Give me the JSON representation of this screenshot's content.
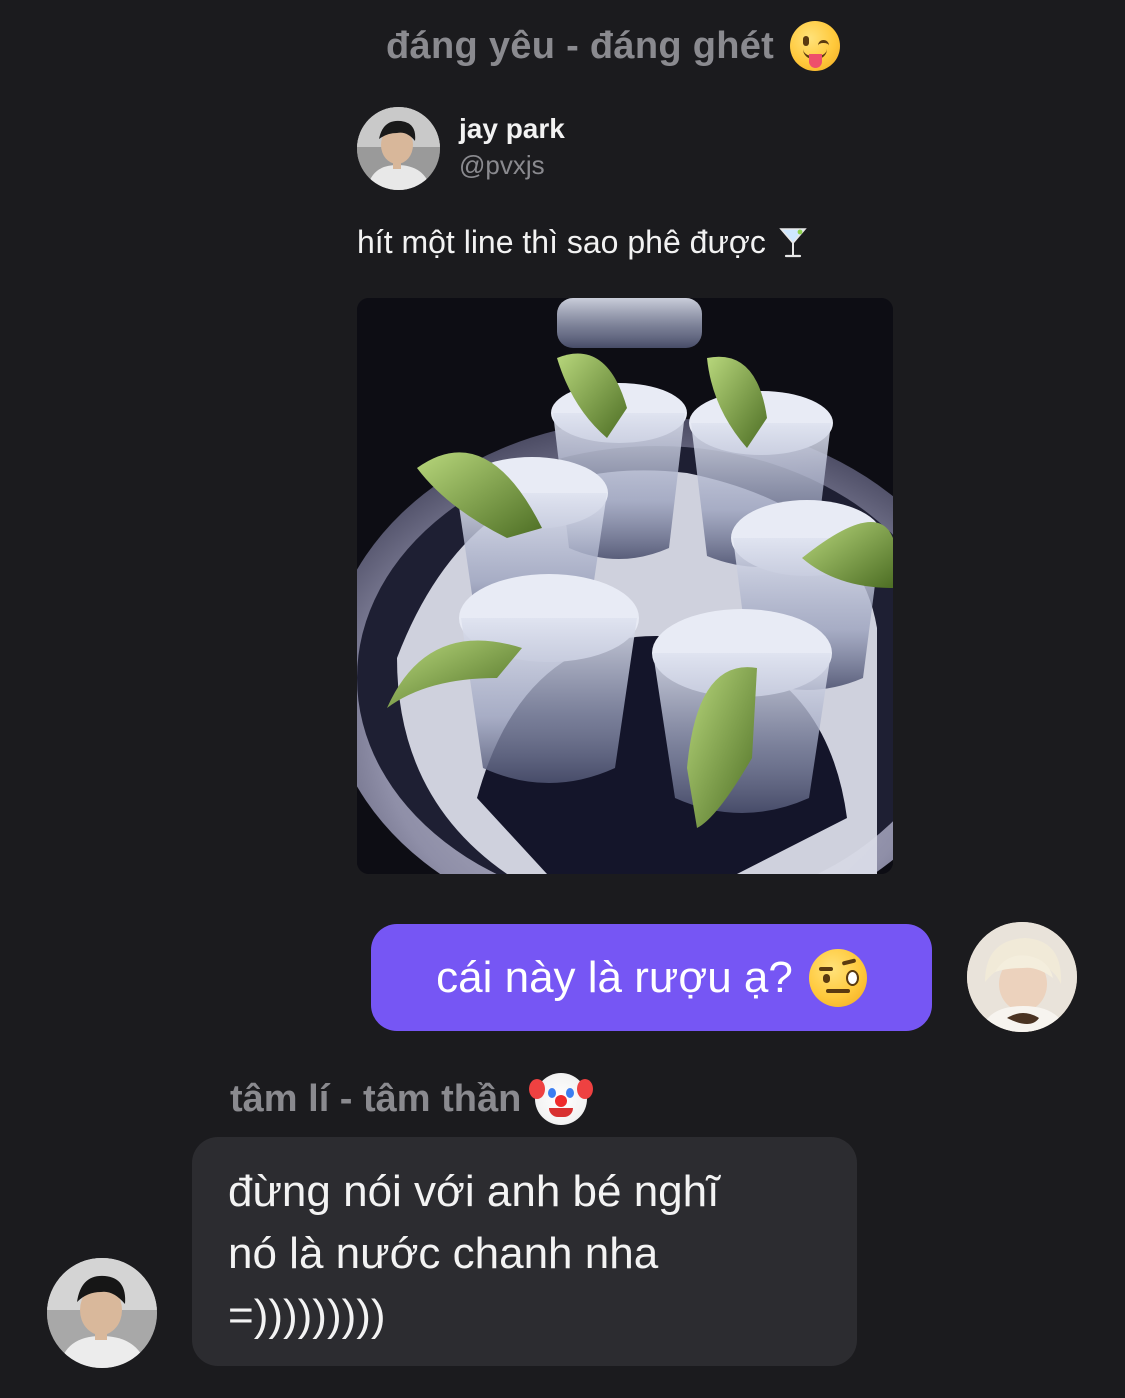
{
  "reply_context": {
    "label": "đáng yêu - đáng ghét",
    "emoji": "face-with-tongue-winking"
  },
  "shared_post": {
    "author_name": "jay park",
    "author_handle": "@pvxjs",
    "text": "hít một line thì sao phê được",
    "text_emoji": "cocktail-glass",
    "image_description_icon": "shot-glasses-with-lime-photo"
  },
  "outgoing_message": {
    "text": "cái này là rượu ạ?",
    "emoji": "face-with-raised-eyebrow",
    "bubble_color": "#7656f4"
  },
  "incoming_message": {
    "sender_label": "tâm lí - tâm thần",
    "sender_emoji": "clown-face",
    "lines": [
      "đừng nói với anh bé nghĩ",
      "nó là nước chanh nha",
      "=)))))))))"
    ],
    "bubble_color": "#2c2c30"
  },
  "colors": {
    "background": "#1b1b1e",
    "muted_text": "#8a8a8f",
    "primary_text": "#f2f2f2"
  }
}
